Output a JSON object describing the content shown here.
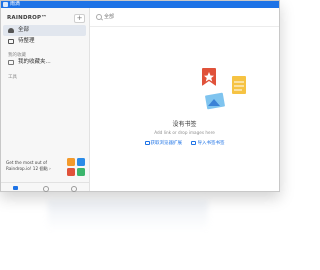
{
  "window": {
    "title": "雨滴"
  },
  "sidebar": {
    "brand": "RAINDROP™",
    "add_label": "+",
    "items": [
      {
        "label": "全部",
        "icon": "cloud-icon",
        "active": true
      },
      {
        "label": "待整理",
        "icon": "inbox-icon",
        "active": false
      }
    ],
    "section_favorites": "我的收藏",
    "collections": [
      {
        "label": "我的收藏夹..."
      }
    ],
    "section_tools": "工具",
    "promo_text": "Get the most out of Raindrop.io! 12 個點 ›",
    "bottom_icons": [
      "bookmarks-icon",
      "info-icon",
      "settings-icon"
    ]
  },
  "search": {
    "placeholder": "全部"
  },
  "empty_state": {
    "title": "没有书签",
    "subtitle": "Add link or drop images here",
    "actions": [
      {
        "label": "获取浏览器扩展",
        "icon": "browser-icon"
      },
      {
        "label": "导入书签书签",
        "icon": "import-icon"
      }
    ]
  },
  "colors": {
    "accent": "#1e73e6",
    "red": "#e0523a",
    "yellow": "#f6c343",
    "sky": "#7fc4ef"
  }
}
